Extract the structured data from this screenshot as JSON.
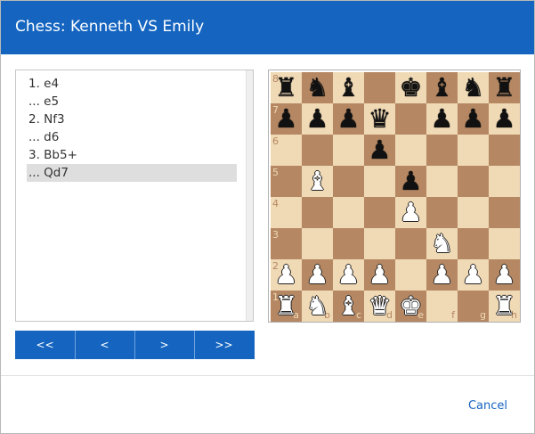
{
  "dialog": {
    "title": "Chess: Kenneth VS Emily",
    "cancel_label": "Cancel"
  },
  "moves": [
    {
      "text": "1. e4",
      "selected": false
    },
    {
      "text": "... e5",
      "selected": false
    },
    {
      "text": "2. Nf3",
      "selected": false
    },
    {
      "text": "... d6",
      "selected": false
    },
    {
      "text": "3. Bb5+",
      "selected": false
    },
    {
      "text": "... Qd7",
      "selected": true
    }
  ],
  "nav": {
    "first_label": "<<",
    "prev_label": "<",
    "next_label": ">",
    "last_label": ">>"
  },
  "board": {
    "ranks": [
      "8",
      "7",
      "6",
      "5",
      "4",
      "3",
      "2",
      "1"
    ],
    "files": [
      "a",
      "b",
      "c",
      "d",
      "e",
      "f",
      "g",
      "h"
    ],
    "position": [
      [
        "r",
        "n",
        "b",
        "",
        "k",
        "b",
        "n",
        "r"
      ],
      [
        "p",
        "p",
        "p",
        "q",
        "",
        "p",
        "p",
        "p"
      ],
      [
        "",
        "",
        "",
        "p",
        "",
        "",
        "",
        ""
      ],
      [
        "",
        "B",
        "",
        "",
        "p",
        "",
        "",
        ""
      ],
      [
        "",
        "",
        "",
        "",
        "P",
        "",
        "",
        ""
      ],
      [
        "",
        "",
        "",
        "",
        "",
        "N",
        "",
        ""
      ],
      [
        "P",
        "P",
        "P",
        "P",
        "",
        "P",
        "P",
        "P"
      ],
      [
        "R",
        "N",
        "B",
        "Q",
        "K",
        "",
        "",
        "R"
      ]
    ],
    "light_color": "#f0d9b5",
    "dark_color": "#b58863"
  },
  "colors": {
    "accent": "#1565c0",
    "selected_row": "#dedede"
  }
}
